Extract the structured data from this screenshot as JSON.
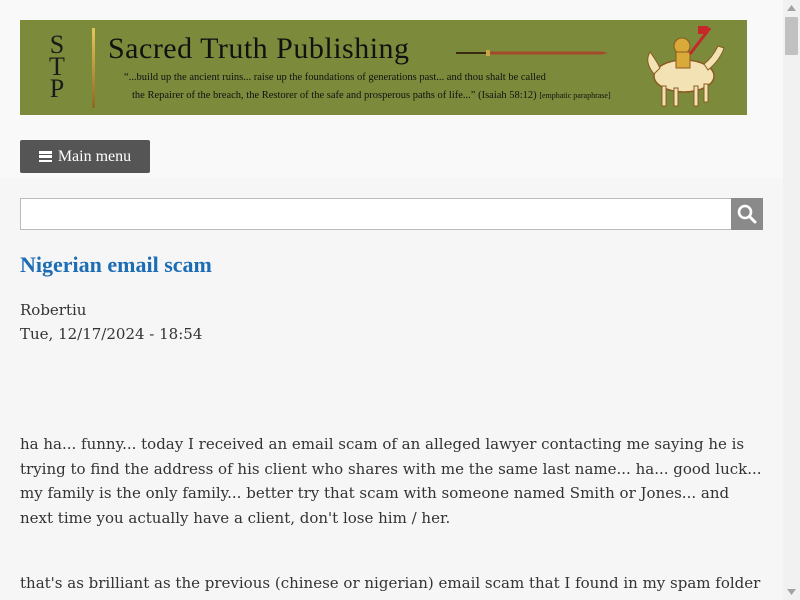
{
  "banner": {
    "logo_letters": [
      "S",
      "T",
      "P"
    ],
    "title": "Sacred Truth Publishing",
    "quote_line1": "“...build up the ancient ruins... raise up the foundations of generations past... and thou shalt be called",
    "quote_line2": "the Repairer of the breach, the Restorer of the safe and prosperous paths of life...” (Isaiah 58:12)",
    "quote_note": "[emphatic paraphrase]",
    "background_color": "#7b8b3b"
  },
  "nav": {
    "menu_label": "Main menu",
    "menu_icon": "hamburger-icon"
  },
  "search": {
    "value": "",
    "button_icon": "search-icon"
  },
  "article": {
    "title": "Nigerian email scam",
    "author": "Robertiu",
    "date": "Tue, 12/17/2024 - 18:54",
    "paragraphs": [
      "ha ha... funny... today I received an email scam of an alleged lawyer contacting me saying he is trying to find the address of his client who shares with me the same last name... ha... good luck... my family is the only family... better try that scam with someone named Smith or Jones... and next time you actually have a client, don't lose him / her.",
      "that's as brilliant as the previous (chinese or nigerian) email scam that I found in my spam folder"
    ]
  },
  "colors": {
    "link_title": "#1d6db5",
    "menu_button": "#555555",
    "search_button": "#8a8a8a"
  }
}
